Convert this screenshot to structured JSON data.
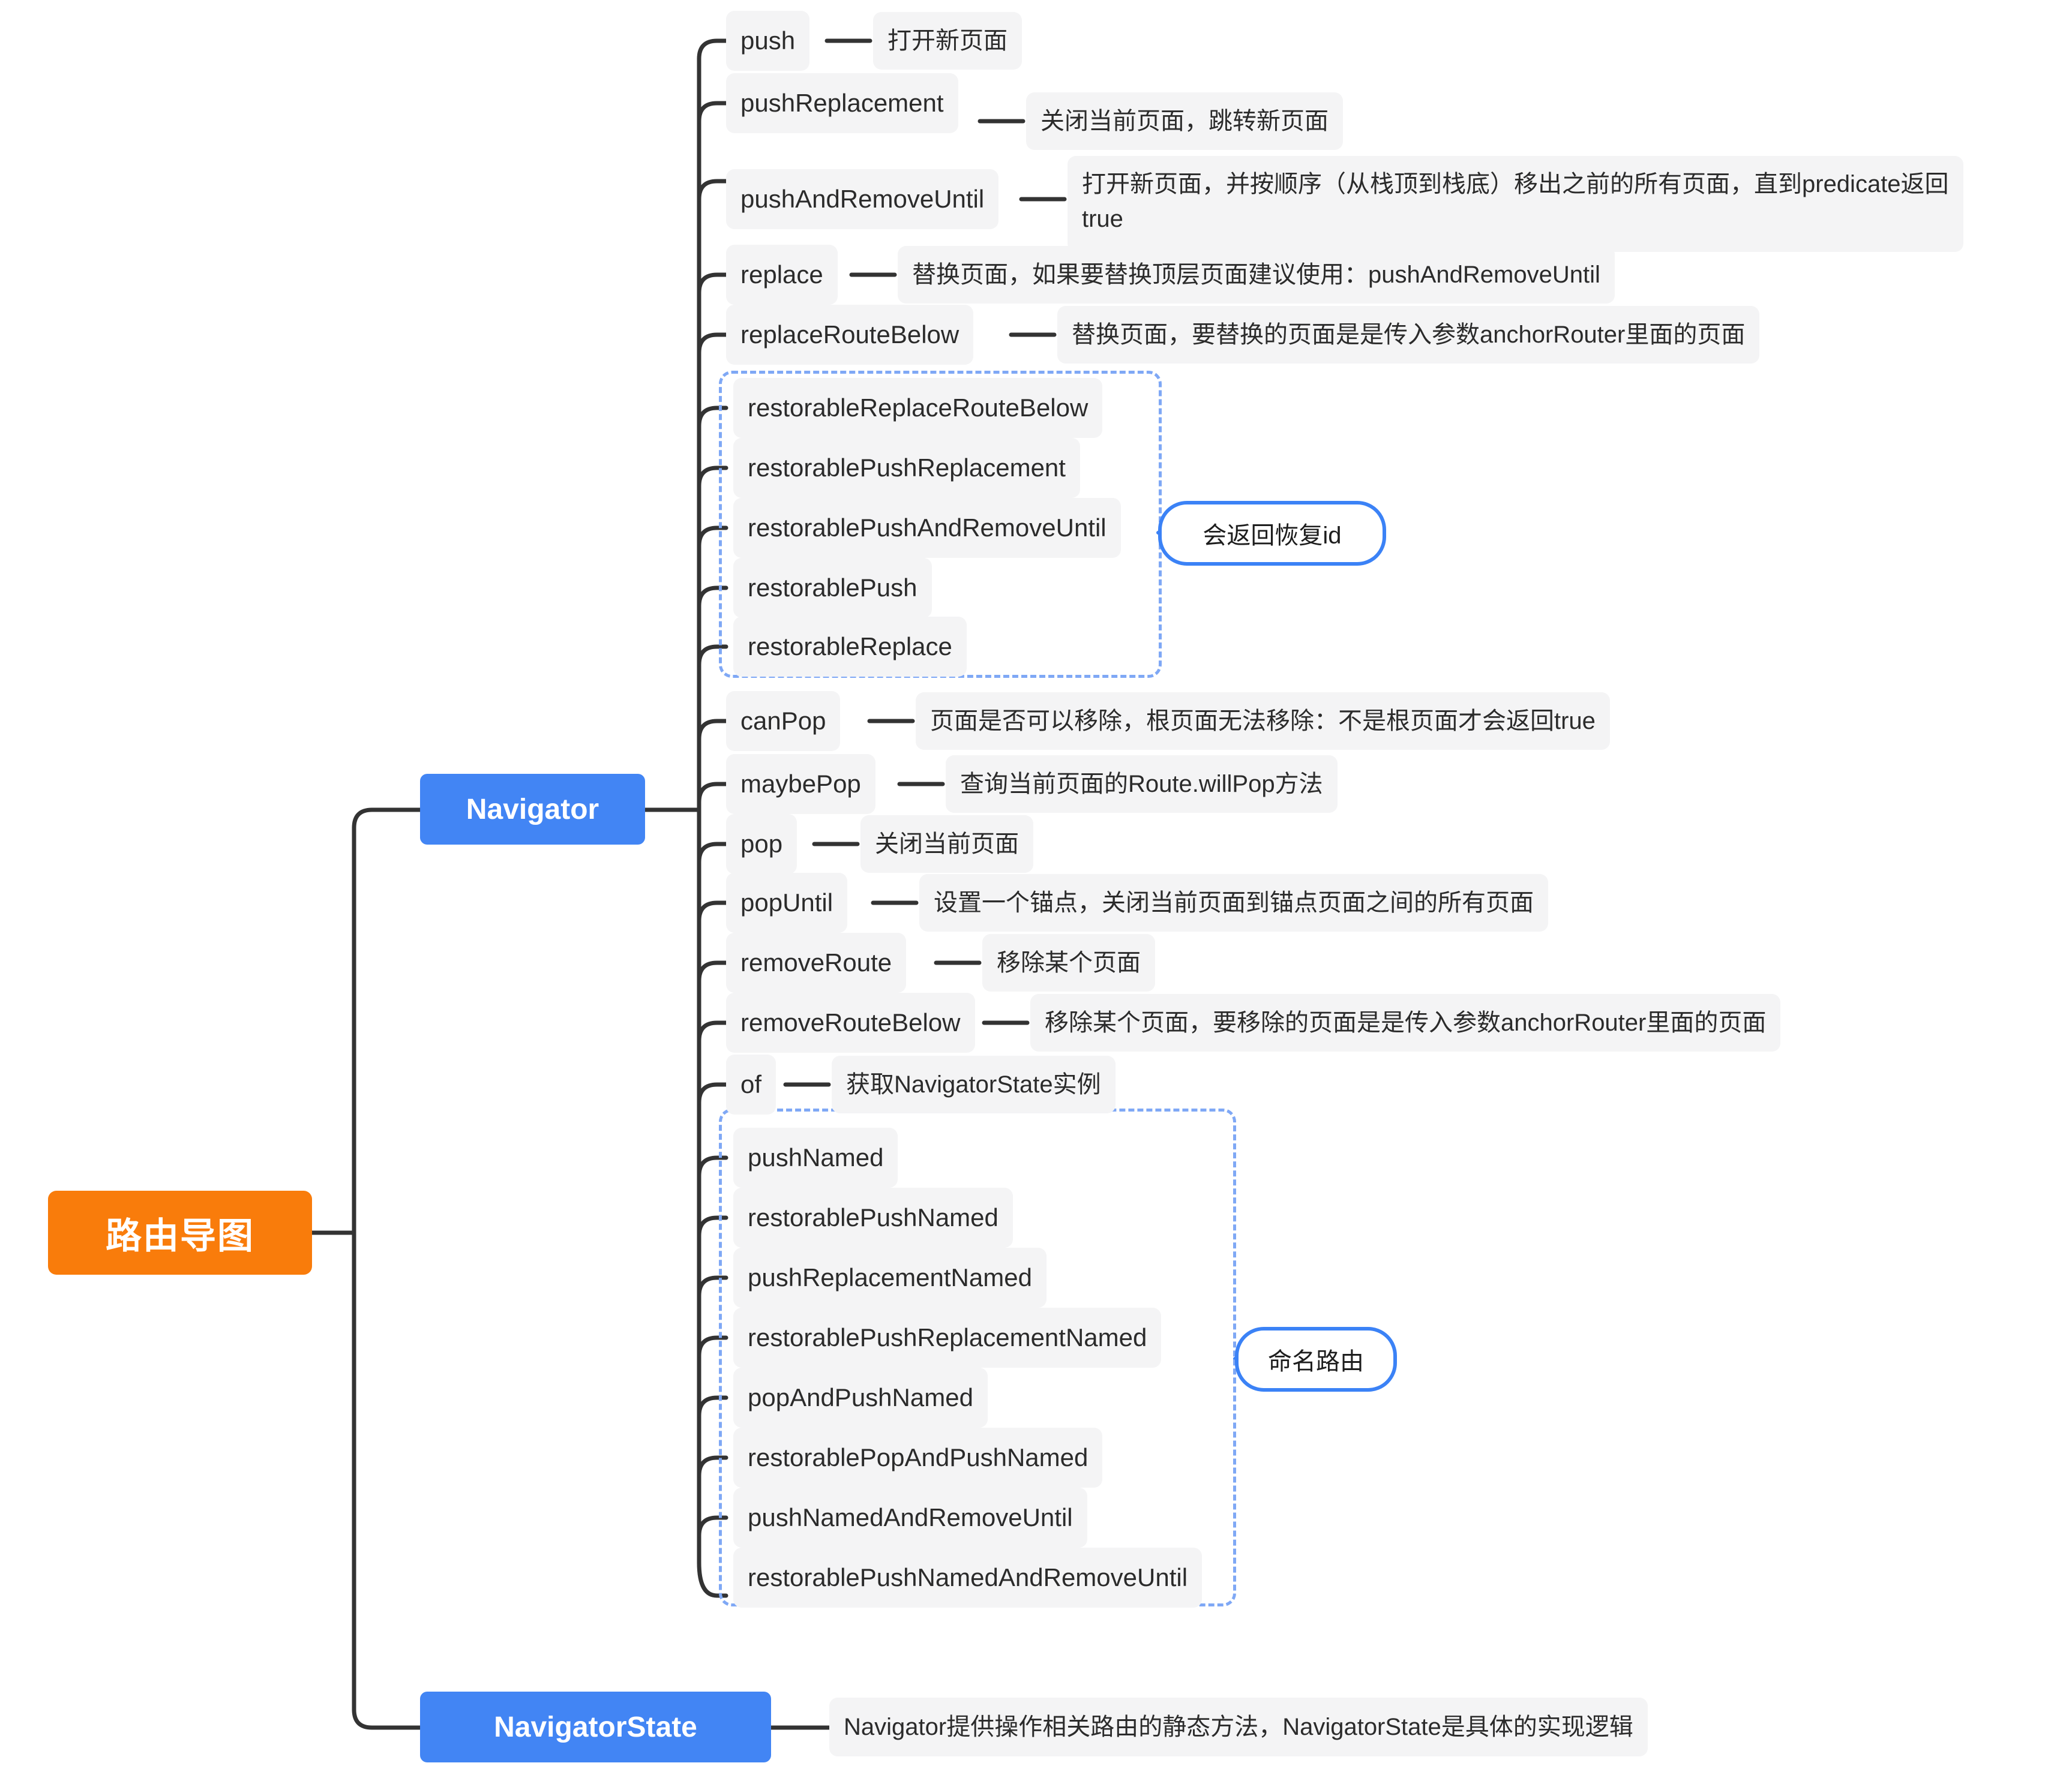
{
  "diagram": {
    "title": "路由导图",
    "root": {
      "label": "路由导图"
    },
    "branches": [
      {
        "label": "Navigator"
      },
      {
        "label": "NavigatorState"
      }
    ],
    "navigator_state_desc": "Navigator提供操作相关路由的静态方法，NavigatorState是具体的实现逻辑",
    "groups": [
      {
        "name": "restorable-group",
        "callout": "会返回恢复id"
      },
      {
        "name": "named-route-group",
        "callout": "命名路由"
      }
    ],
    "colors": {
      "root": "#F97C0B",
      "branch": "#4285F4",
      "leaf": "#F4F4F5",
      "group_border": "#7FA8F5",
      "callout_border": "#3B82F6",
      "wire": "#333333"
    },
    "methods": [
      {
        "name": "push",
        "desc": "打开新页面"
      },
      {
        "name": "pushReplacement",
        "desc": "关闭当前页面，跳转新页面"
      },
      {
        "name": "pushAndRemoveUntil",
        "desc": "打开新页面，并按顺序（从栈顶到栈底）移出之前的所有页面，直到predicate返回\ntrue"
      },
      {
        "name": "replace",
        "desc": "替换页面，如果要替换顶层页面建议使用：pushAndRemoveUntil"
      },
      {
        "name": "replaceRouteBelow",
        "desc": "替换页面，要替换的页面是是传入参数anchorRouter里面的页面"
      },
      {
        "name": "restorableReplaceRouteBelow",
        "desc": ""
      },
      {
        "name": "restorablePushReplacement",
        "desc": ""
      },
      {
        "name": "restorablePushAndRemoveUntil",
        "desc": ""
      },
      {
        "name": "restorablePush",
        "desc": ""
      },
      {
        "name": "restorableReplace",
        "desc": ""
      },
      {
        "name": "canPop",
        "desc": "页面是否可以移除，根页面无法移除：不是根页面才会返回true"
      },
      {
        "name": "maybePop",
        "desc": "查询当前页面的Route.willPop方法"
      },
      {
        "name": "pop",
        "desc": "关闭当前页面"
      },
      {
        "name": "popUntil",
        "desc": "设置一个锚点，关闭当前页面到锚点页面之间的所有页面"
      },
      {
        "name": "removeRoute",
        "desc": "移除某个页面"
      },
      {
        "name": "removeRouteBelow",
        "desc": "移除某个页面，要移除的页面是是传入参数anchorRouter里面的页面"
      },
      {
        "name": "of",
        "desc": "获取NavigatorState实例"
      },
      {
        "name": "pushNamed",
        "desc": ""
      },
      {
        "name": "restorablePushNamed",
        "desc": ""
      },
      {
        "name": "pushReplacementNamed",
        "desc": ""
      },
      {
        "name": "restorablePushReplacementNamed",
        "desc": ""
      },
      {
        "name": "popAndPushNamed",
        "desc": ""
      },
      {
        "name": "restorablePopAndPushNamed",
        "desc": ""
      },
      {
        "name": "pushNamedAndRemoveUntil",
        "desc": ""
      },
      {
        "name": "restorablePushNamedAndRemoveUntil",
        "desc": ""
      }
    ]
  }
}
